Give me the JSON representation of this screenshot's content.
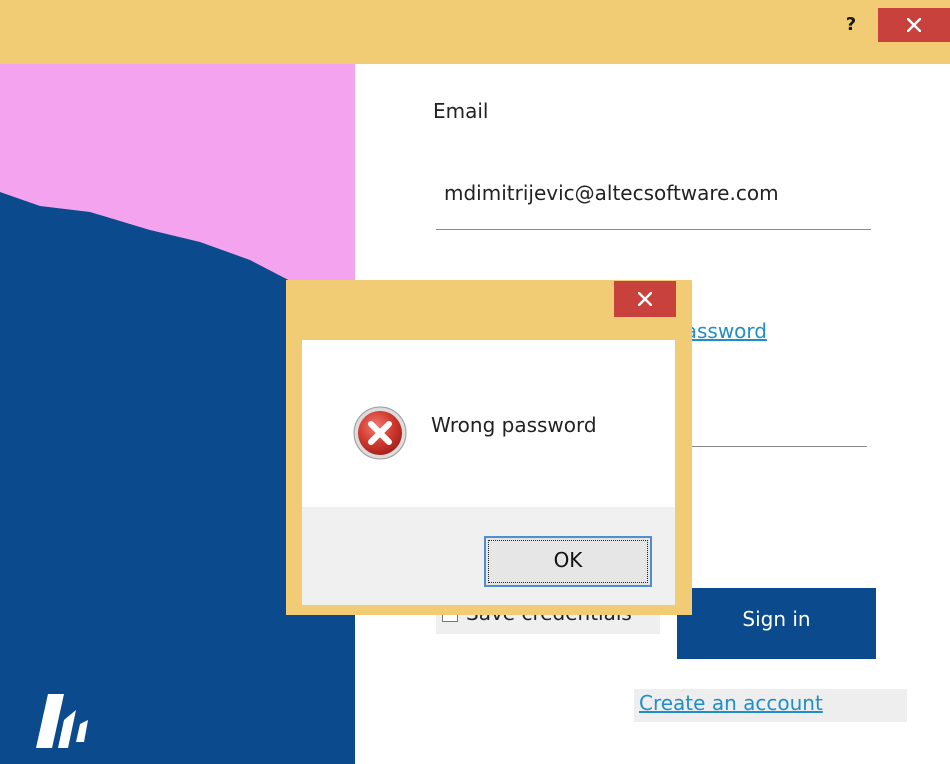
{
  "window": {
    "help_label": "?"
  },
  "form": {
    "email_label": "Email",
    "email_value": "mdimitrijevic@altecsoftware.com",
    "forgot_password_label": "Forgot password",
    "save_credentials_label": "Save credentials",
    "sign_in_label": "Sign in",
    "create_account_label": "Create an account"
  },
  "dialog": {
    "message": "Wrong password",
    "ok_label": "OK",
    "icon": "error-icon"
  },
  "colors": {
    "title_bar": "#f1cc75",
    "close_button": "#c9413c",
    "primary_button": "#0b4a8d",
    "link": "#1f8ecb",
    "art_pink": "#f4a3ef",
    "art_blue": "#0b4a8d"
  }
}
